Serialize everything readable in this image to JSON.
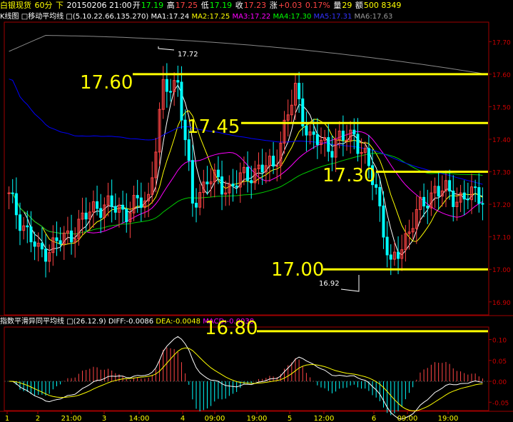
{
  "header": {
    "symbol": "白银现货",
    "period": "60分",
    "direction": "下",
    "datetime": "20150206 21:00",
    "open_label": "开",
    "open": "17.19",
    "high_label": "高",
    "high": "17.25",
    "low_label": "低",
    "low": "17.19",
    "close_label": "收",
    "close": "17.23",
    "change_label": "涨",
    "change": "+0.03",
    "change_pct": "0.17%",
    "volume_label": "量",
    "volume": "29",
    "amount_label": "额",
    "amount": "500 8349"
  },
  "main_indicator": {
    "chart_label": "K线图",
    "ma_name": "移动平均线",
    "params": "(5.10.22.66.135.270)",
    "ma1": "MA1:17.24",
    "ma2": "MA2:17.25",
    "ma3": "MA3:17.22",
    "ma4": "MA4:17.30",
    "ma5": "MA5:17.31",
    "ma6": "MA6:17.63"
  },
  "sub_indicator": {
    "name": "指数平滑异同平均线",
    "params": "(26.12.9)",
    "diff": "DIFF:-0.0086",
    "dea": "DEA:-0.0048",
    "macd": "MACD:-0.0038"
  },
  "annotations": {
    "a1760": "17.60",
    "a1745": "17.45",
    "a1730": "17.30",
    "a1700": "17.00",
    "a1680": "16.80",
    "peak": "17.72",
    "trough": "16.92"
  },
  "chart_data": [
    {
      "type": "candlestick",
      "y_ticks": [
        "17.70",
        "17.60",
        "17.50",
        "17.40",
        "17.30",
        "17.20",
        "17.10",
        "17.00",
        "16.90"
      ],
      "ylim": [
        16.86,
        17.76
      ],
      "x_ticks": [
        "1",
        "2",
        "21:00",
        "3",
        "14:00",
        "4",
        "09:00",
        "19:00",
        "5",
        "12:00",
        "6",
        "09:00",
        "19:00"
      ],
      "bar_count": 130,
      "ohlc_anchors": [
        {
          "bar": 0,
          "close": 17.22
        },
        {
          "bar": 8,
          "close": 17.05
        },
        {
          "bar": 16,
          "close": 17.1
        },
        {
          "bar": 24,
          "close": 17.2
        },
        {
          "bar": 32,
          "close": 17.18
        },
        {
          "bar": 38,
          "close": 17.22
        },
        {
          "bar": 42,
          "close": 17.55
        },
        {
          "bar": 46,
          "close": 17.58
        },
        {
          "bar": 50,
          "close": 17.2
        },
        {
          "bar": 54,
          "close": 17.28
        },
        {
          "bar": 60,
          "close": 17.25
        },
        {
          "bar": 66,
          "close": 17.3
        },
        {
          "bar": 72,
          "close": 17.32
        },
        {
          "bar": 78,
          "close": 17.55
        },
        {
          "bar": 82,
          "close": 17.4
        },
        {
          "bar": 88,
          "close": 17.38
        },
        {
          "bar": 94,
          "close": 17.42
        },
        {
          "bar": 100,
          "close": 17.25
        },
        {
          "bar": 104,
          "close": 17.0
        },
        {
          "bar": 110,
          "close": 17.15
        },
        {
          "bar": 116,
          "close": 17.25
        },
        {
          "bar": 122,
          "close": 17.22
        },
        {
          "bar": 129,
          "close": 17.23
        }
      ],
      "ma_lines": [
        {
          "name": "MA1",
          "color": "#ffffff"
        },
        {
          "name": "MA2",
          "color": "#ffff00"
        },
        {
          "name": "MA3",
          "color": "#ff00ff"
        },
        {
          "name": "MA4",
          "color": "#00cc00"
        },
        {
          "name": "MA5",
          "color": "#0000ff"
        },
        {
          "name": "MA6",
          "color": "#888888"
        }
      ],
      "horizontal_levels": [
        17.6,
        17.45,
        17.3,
        17.0
      ]
    },
    {
      "type": "bar",
      "name": "MACD",
      "y_ticks": [
        "0.10",
        "0.05",
        "0.00",
        "-0.05"
      ],
      "ylim": [
        -0.07,
        0.13
      ],
      "horizontal_levels": [
        0.12
      ]
    }
  ],
  "colors": {
    "up": "#ff4444",
    "down": "#00ffff",
    "axis": "#a00000",
    "level": "#ffff00",
    "ma1": "#ffffff",
    "ma2": "#ffff00",
    "ma3": "#ff00ff",
    "ma4": "#00cc00",
    "ma5": "#2222ff",
    "ma6": "#888888"
  }
}
